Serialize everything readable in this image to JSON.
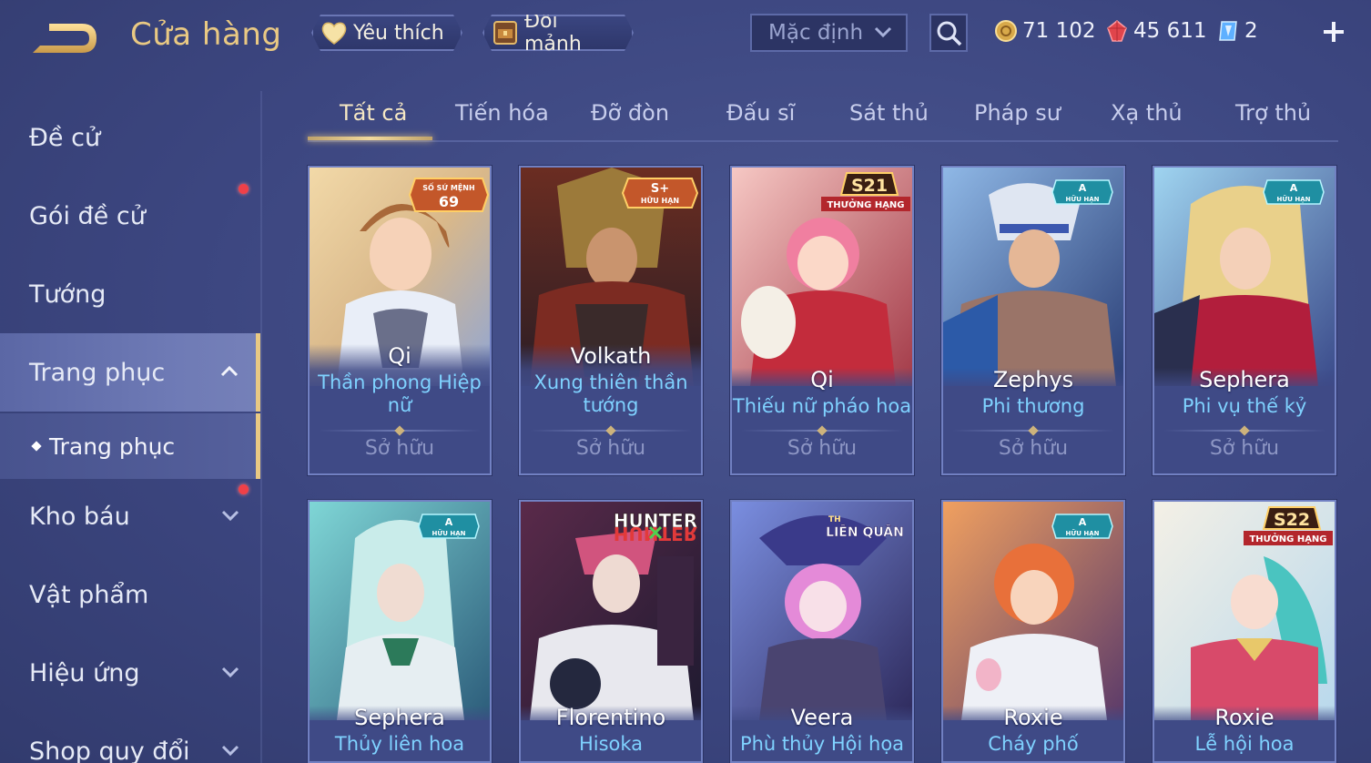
{
  "header": {
    "title": "Cửa hàng",
    "favorite_label": "Yêu thích",
    "shard_label": "Đổi mảnh",
    "sort_value": "Mặc định",
    "gold": "71 102",
    "ruby": "45 611",
    "voucher": "2"
  },
  "sidebar": {
    "items": [
      {
        "label": "Đề cử"
      },
      {
        "label": "Gói đề cử"
      },
      {
        "label": "Tướng"
      },
      {
        "label": "Trang phục"
      },
      {
        "label": "Trang phục"
      },
      {
        "label": "Kho báu"
      },
      {
        "label": "Vật phẩm"
      },
      {
        "label": "Hiệu ứng"
      },
      {
        "label": "Shop quy đổi"
      }
    ]
  },
  "tabs": [
    "Tất cả",
    "Tiến hóa",
    "Đỡ đòn",
    "Đấu sĩ",
    "Sát thủ",
    "Pháp sư",
    "Xạ thủ",
    "Trợ thủ"
  ],
  "active_tab": "Tất cả",
  "cards": [
    {
      "hero": "Qi",
      "skin": "Thần phong Hiệp",
      "skin2": "nữ",
      "status": "Sở hữu",
      "badge": "SỐ SỨ MỆNH",
      "badge2": "69"
    },
    {
      "hero": "Volkath",
      "skin": "Xung thiên thần",
      "skin2": "tướng",
      "status": "Sở hữu",
      "badge": "S+",
      "badge2": "HỮU HẠN"
    },
    {
      "hero": "Qi",
      "skin": "Thiếu nữ pháo hoa",
      "status": "Sở hữu",
      "badge": "S21",
      "badge2": "THƯỞNG HẠNG"
    },
    {
      "hero": "Zephys",
      "skin": "Phi thương",
      "status": "Sở hữu",
      "badge": "A",
      "badge2": "HỮU HẠN"
    },
    {
      "hero": "Sephera",
      "skin": "Phi vụ thế kỷ",
      "status": "Sở hữu",
      "badge": "A",
      "badge2": "HỮU HẠN"
    },
    {
      "hero": "Sephera",
      "skin": "Thủy liên hoa",
      "badge": "A",
      "badge2": "HỮU HẠN"
    },
    {
      "hero": "Florentino",
      "skin": "Hisoka",
      "badge": "HUNTER",
      "badge2": "HUNTER"
    },
    {
      "hero": "Veera",
      "skin": "Phù thủy Hội họa",
      "badge": "LIÊN QUÂN",
      "badge2": "TH"
    },
    {
      "hero": "Roxie",
      "skin": "Cháy phố",
      "badge": "A",
      "badge2": "HỮU HẠN"
    },
    {
      "hero": "Roxie",
      "skin": "Lễ hội hoa",
      "badge": "S22",
      "badge2": "THƯỞNG HẠNG"
    }
  ],
  "colors": {
    "gold_accent": "#e9c983",
    "skin_text": "#7fd2ff",
    "background": "#3c4680",
    "notify_dot": "#f04048"
  },
  "icons": [
    "back-arrow-icon",
    "heart-icon",
    "chest-icon",
    "chevron-down-icon",
    "search-icon",
    "gold-coin-icon",
    "ruby-icon",
    "voucher-icon",
    "plus-icon",
    "chevron-up-icon"
  ]
}
